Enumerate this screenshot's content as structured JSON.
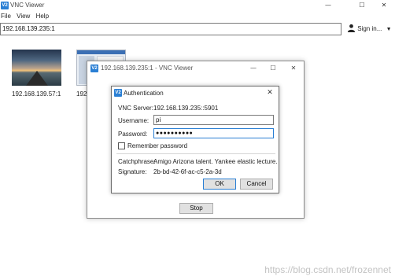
{
  "app": {
    "title": "VNC Viewer",
    "logo": "V2"
  },
  "menu": [
    "File",
    "View",
    "Help"
  ],
  "address_bar": {
    "value": "192.168.139.235:1"
  },
  "account": {
    "sign_in_label": "Sign in...",
    "icon": "person-icon"
  },
  "thumbnails": [
    {
      "label": "192.168.139.57:1"
    },
    {
      "label": "192"
    }
  ],
  "connection_window": {
    "title": "192.168.139.235:1 - VNC Viewer",
    "stop_label": "Stop"
  },
  "auth_dialog": {
    "title": "Authentication",
    "server_label": "VNC Server:",
    "server_value": "192.168.139.235::5901",
    "username_label": "Username:",
    "username_value": "pi",
    "password_label": "Password:",
    "password_value": "●●●●●●●●●●",
    "remember_label": "Remember password",
    "catchphrase_label": "Catchphrase:",
    "catchphrase_value": "Amigo Arizona talent. Yankee elastic lecture.",
    "signature_label": "Signature:",
    "signature_value": "2b-bd-42-6f-ac-c5-2a-3d",
    "ok_label": "OK",
    "cancel_label": "Cancel"
  },
  "watermark": "https://blog.csdn.net/frozennet",
  "colors": {
    "accent": "#2a7fd4",
    "button_bg": "#e1e1e1"
  }
}
